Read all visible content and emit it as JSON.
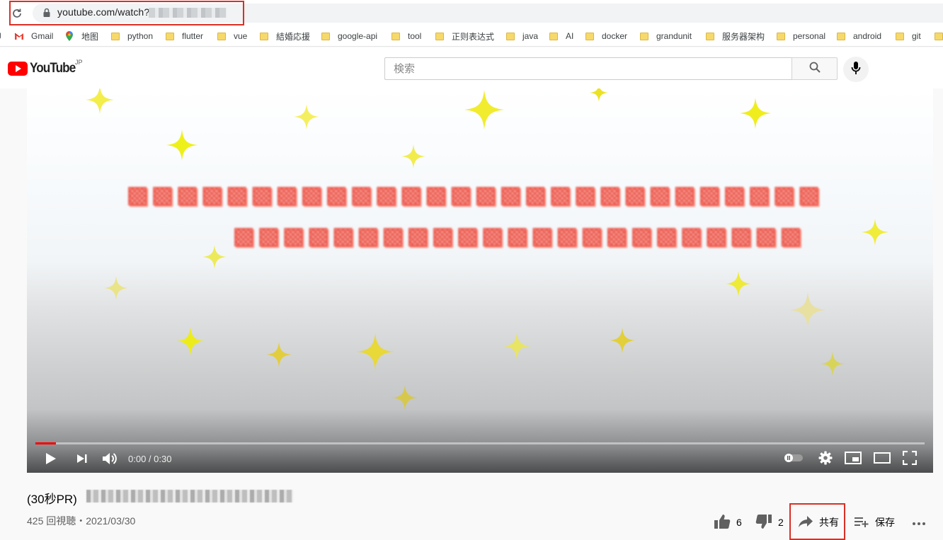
{
  "browser": {
    "url": "youtube.com/watch?"
  },
  "bookmarks": [
    {
      "label": "Gmail",
      "icon": "gmail-icon"
    },
    {
      "label": "地图",
      "icon": "maps-pin-icon"
    },
    {
      "label": "python",
      "icon": "folder-icon"
    },
    {
      "label": "flutter",
      "icon": "folder-icon"
    },
    {
      "label": "vue",
      "icon": "folder-icon"
    },
    {
      "label": "結婚応援",
      "icon": "folder-icon"
    },
    {
      "label": "google-api",
      "icon": "folder-icon"
    },
    {
      "label": "tool",
      "icon": "folder-icon"
    },
    {
      "label": "正则表达式",
      "icon": "folder-icon"
    },
    {
      "label": "java",
      "icon": "folder-icon"
    },
    {
      "label": "AI",
      "icon": "folder-icon"
    },
    {
      "label": "docker",
      "icon": "folder-icon"
    },
    {
      "label": "grandunit",
      "icon": "folder-icon"
    },
    {
      "label": "服务器架构",
      "icon": "folder-icon"
    },
    {
      "label": "personal",
      "icon": "folder-icon"
    },
    {
      "label": "android",
      "icon": "folder-icon"
    },
    {
      "label": "git",
      "icon": "folder-icon"
    }
  ],
  "youtube": {
    "logo_text": "YouTube",
    "country": "JP",
    "search_placeholder": "検索"
  },
  "player": {
    "time": "0:00 / 0:30",
    "progress_fraction": 0.023,
    "progress_color": "#ff0000"
  },
  "video_info": {
    "title_prefix": "(30秒PR)",
    "views_date": "425 回視聴・2021/03/30"
  },
  "actions": {
    "like_count": "6",
    "dislike_count": "2",
    "share_label": "共有",
    "save_label": "保存"
  },
  "colors": {
    "highlight": "#d93025",
    "brand_red": "#ff0000"
  }
}
